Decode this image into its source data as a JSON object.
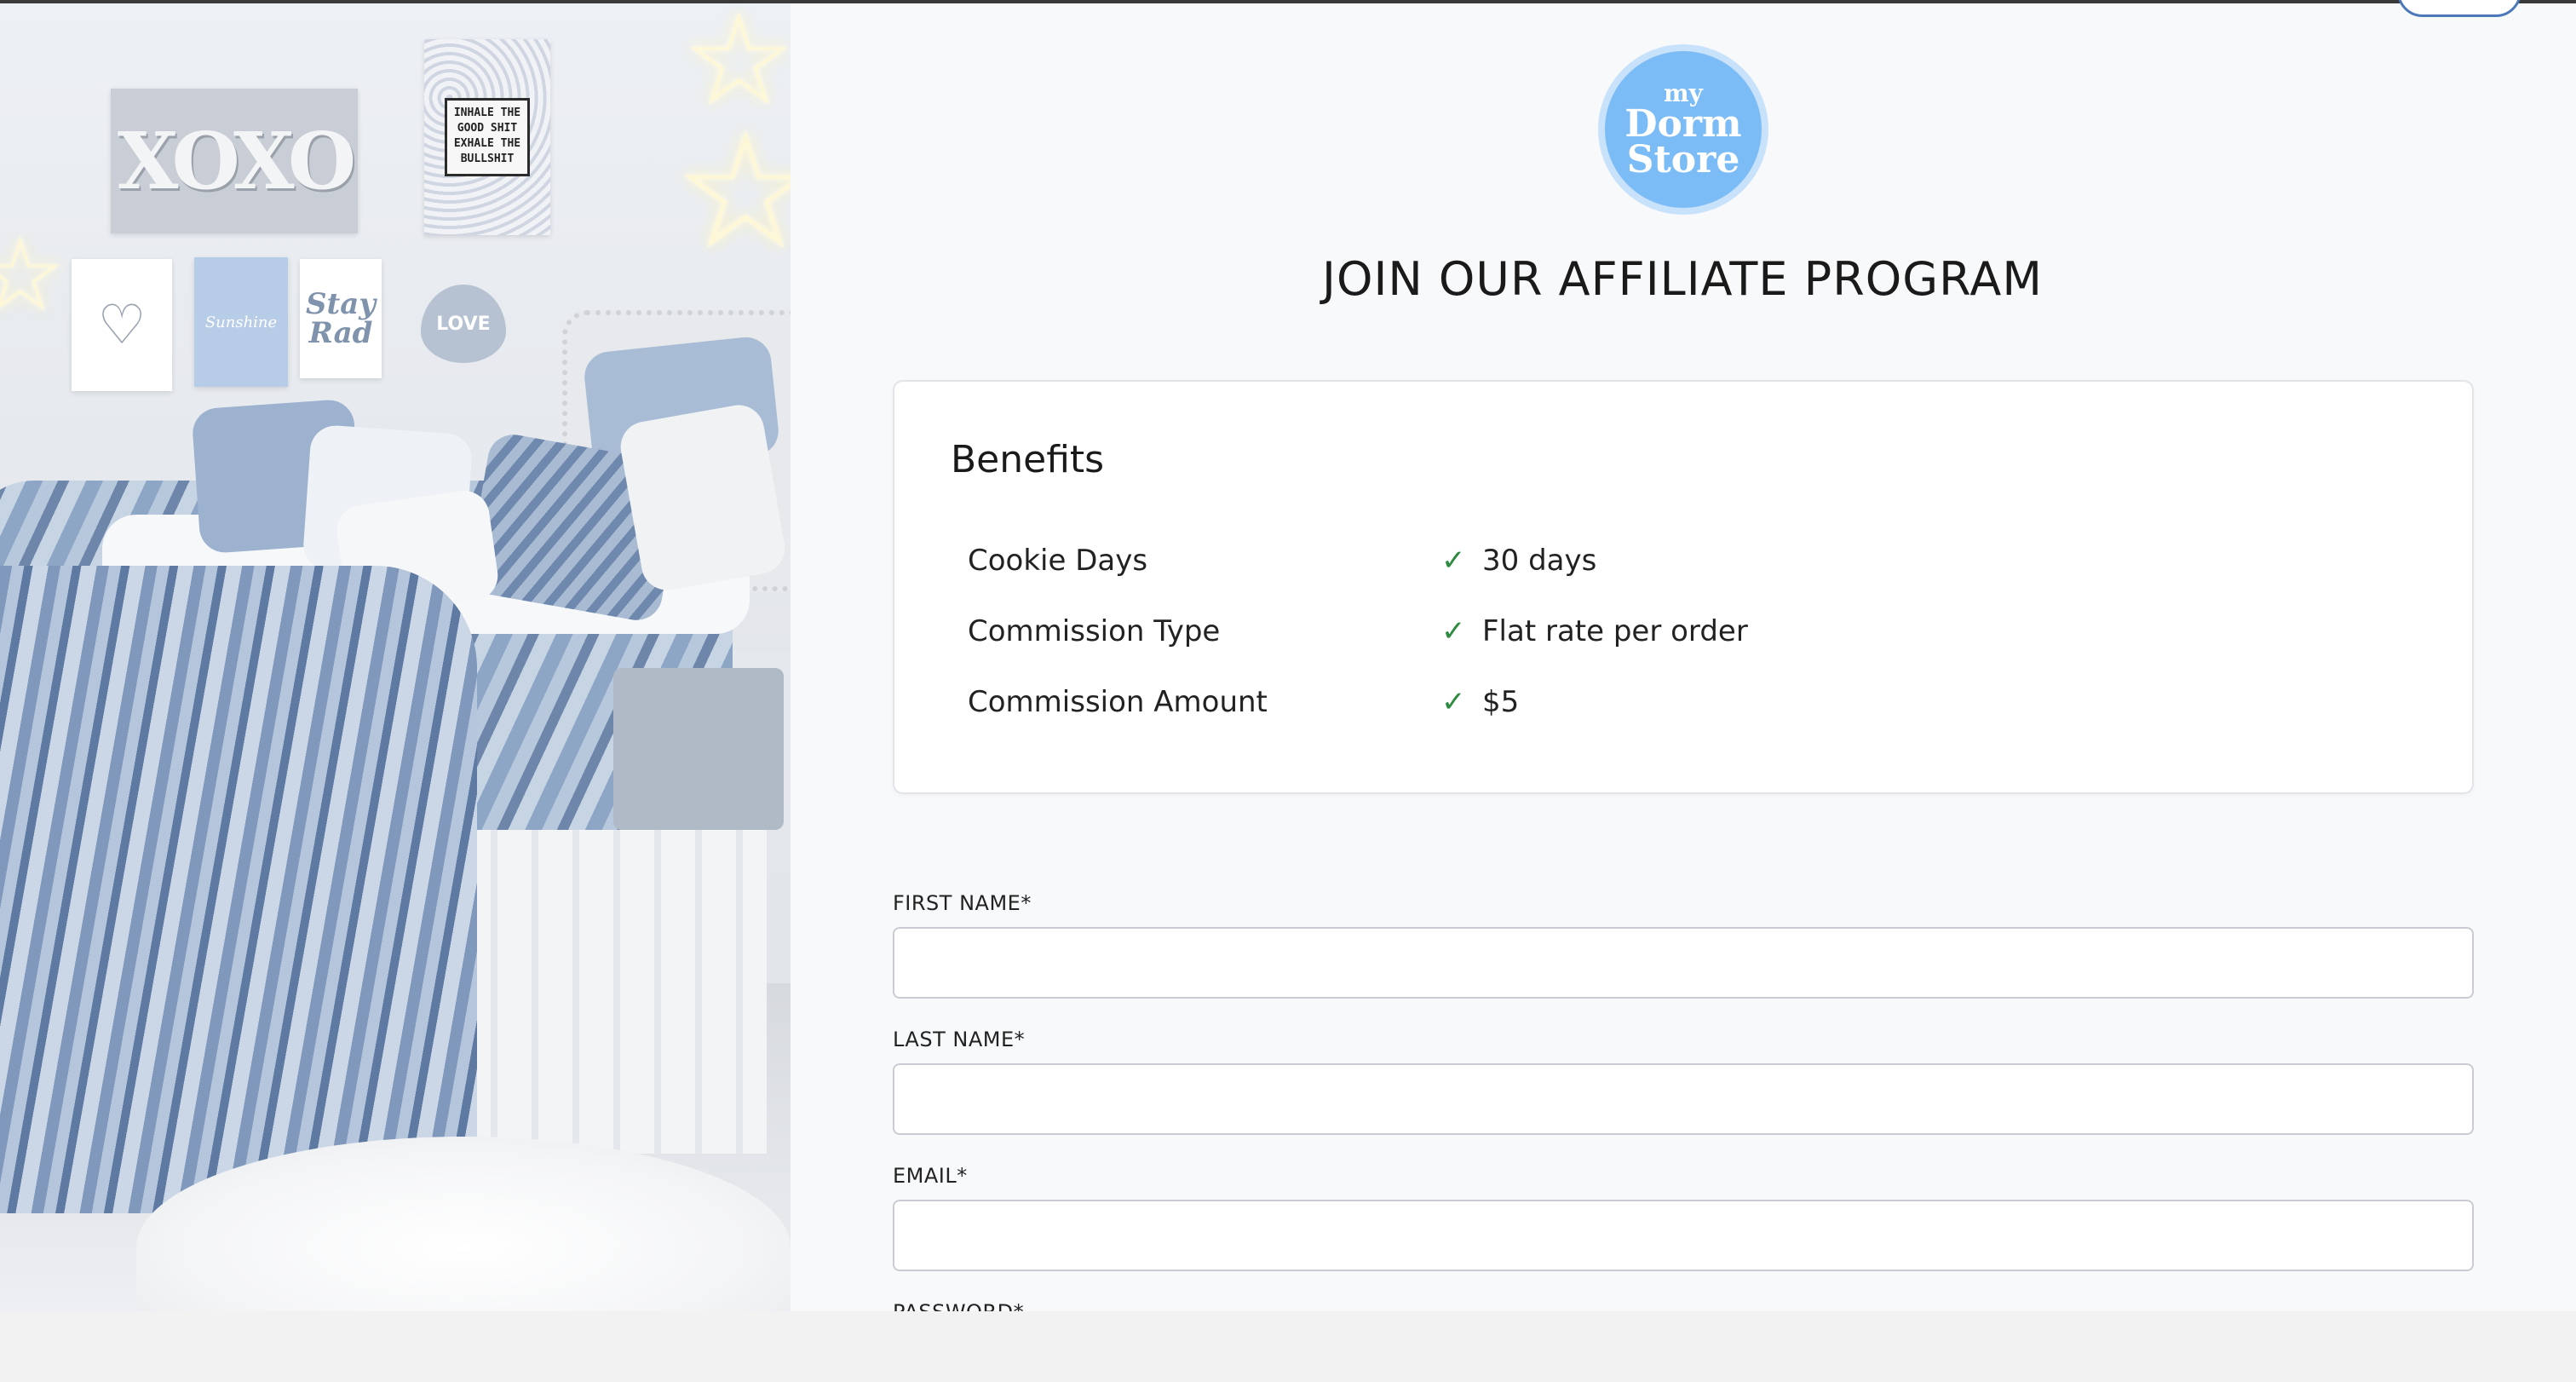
{
  "brand": {
    "logo_line1": "my",
    "logo_line2": "Dorm",
    "logo_line3": "Store"
  },
  "page": {
    "title": "JOIN OUR AFFILIATE PROGRAM"
  },
  "hero_art": {
    "xoxo": "XOXO",
    "poster_lines": [
      "INHALE THE",
      "GOOD SHIT",
      "EXHALE THE",
      "BULLSHIT"
    ],
    "love_sign": "LOVE",
    "stay_rad": "Stay Rad",
    "blue_poster": "Sunshine"
  },
  "benefits": {
    "heading": "Benefits",
    "items": [
      {
        "label": "Cookie Days",
        "value": "30 days"
      },
      {
        "label": "Commission Type",
        "value": "Flat rate per order"
      },
      {
        "label": "Commission Amount",
        "value": "$5"
      }
    ]
  },
  "form": {
    "first_name": {
      "label": "FIRST NAME*",
      "value": ""
    },
    "last_name": {
      "label": "LAST NAME*",
      "value": ""
    },
    "email": {
      "label": "EMAIL*",
      "value": ""
    },
    "password": {
      "label": "PASSWORD*"
    }
  },
  "icons": {
    "check": "check-icon"
  },
  "colors": {
    "check": "#2d8a3e",
    "logo_bg": "#7cbcf6",
    "login_border": "#4a78b8"
  }
}
